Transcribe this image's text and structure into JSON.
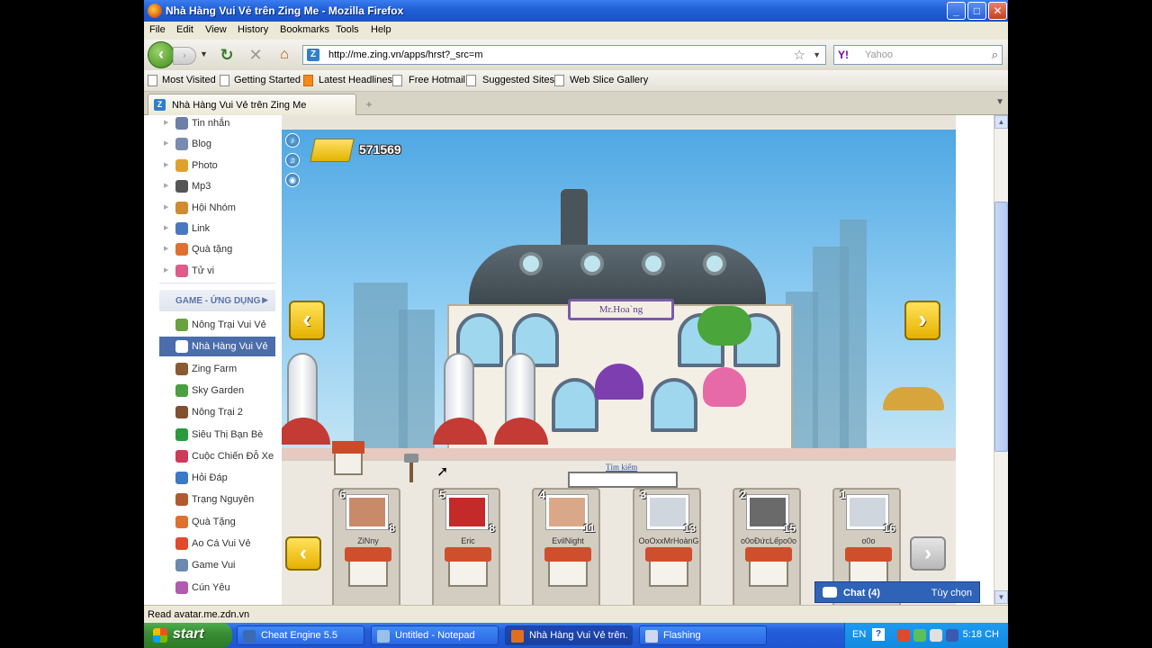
{
  "window": {
    "title": "Nhà Hàng Vui Vẻ trên Zing Me - Mozilla Firefox",
    "controls": [
      "minimize",
      "maximize",
      "close"
    ]
  },
  "menu": [
    "File",
    "Edit",
    "View",
    "History",
    "Bookmarks",
    "Tools",
    "Help"
  ],
  "nav": {
    "url": "http://me.zing.vn/apps/hrst?_src=m",
    "search_placeholder": "Yahoo",
    "search_engine_icon": "Y!"
  },
  "bookmarks": [
    "Most Visited",
    "Getting Started",
    "Latest Headlines",
    "Free Hotmail",
    "Suggested Sites",
    "Web Slice Gallery"
  ],
  "tab": {
    "label": "Nhà Hàng Vui Vẻ trên Zing Me",
    "new_tab": "+"
  },
  "sidebar": {
    "top_items": [
      {
        "label": "Tin nhắn",
        "icon": "message-icon",
        "color": "#6b7fa8"
      },
      {
        "label": "Blog",
        "icon": "blog-icon",
        "color": "#7a8bb0"
      },
      {
        "label": "Photo",
        "icon": "photo-icon",
        "color": "#e0a030"
      },
      {
        "label": "Mp3",
        "icon": "headphones-icon",
        "color": "#555555"
      },
      {
        "label": "Hội Nhóm",
        "icon": "group-icon",
        "color": "#d08a30"
      },
      {
        "label": "Link",
        "icon": "link-icon",
        "color": "#4a78c0"
      },
      {
        "label": "Quà tặng",
        "icon": "gift-icon",
        "color": "#e07030"
      },
      {
        "label": "Tử vi",
        "icon": "horoscope-icon",
        "color": "#e05a8a"
      }
    ],
    "section_title": "GAME - ỨNG DỤNG",
    "apps": [
      {
        "label": "Nông Trại Vui Vẻ",
        "icon": "plant-icon",
        "color": "#6aa040"
      },
      {
        "label": "Nhà Hàng Vui Vẻ",
        "icon": "chef-icon",
        "color": "#ffffff",
        "active": true
      },
      {
        "label": "Zing Farm",
        "icon": "cow-icon",
        "color": "#8a5a30"
      },
      {
        "label": "Sky Garden",
        "icon": "garden-icon",
        "color": "#4aa040"
      },
      {
        "label": "Nông Trại 2",
        "icon": "farmer-icon",
        "color": "#805030"
      },
      {
        "label": "Siêu Thị Bạn Bè",
        "icon": "dollar-icon",
        "color": "#2a9a3a"
      },
      {
        "label": "Cuộc Chiến Đỗ Xe",
        "icon": "car-icon",
        "color": "#d03a5a"
      },
      {
        "label": "Hỏi Đáp",
        "icon": "question-icon",
        "color": "#3a78c8"
      },
      {
        "label": "Trạng Nguyên",
        "icon": "scholar-icon",
        "color": "#b05a30"
      },
      {
        "label": "Quà Tặng",
        "icon": "gift-icon",
        "color": "#e07030"
      },
      {
        "label": "Ao Cá Vui Vẻ",
        "icon": "fish-icon",
        "color": "#e04a2a"
      },
      {
        "label": "Game Vui",
        "icon": "gamepad-icon",
        "color": "#6a8ab0"
      },
      {
        "label": "Cún Yêu",
        "icon": "dog-icon",
        "color": "#b05ab0"
      }
    ]
  },
  "game": {
    "gold": "571569",
    "restaurant_sign": "Mr.Hoa`ng",
    "search_label": "Tìm kiếm",
    "search_value": "",
    "friends": [
      {
        "rank": "6",
        "name": "ZiNny",
        "level": "8",
        "photo_color": "#c98a6a"
      },
      {
        "rank": "5",
        "name": "Eric",
        "level": "8",
        "photo_color": "#c42a2a"
      },
      {
        "rank": "4",
        "name": "EvilNight",
        "level": "11",
        "photo_color": "#d9a888"
      },
      {
        "rank": "3",
        "name": "OoOxxMrHoànG",
        "level": "13",
        "photo_color": "#cfd6de"
      },
      {
        "rank": "2",
        "name": "o0oĐứcLếpo0o",
        "level": "15",
        "photo_color": "#6a6a6a"
      },
      {
        "rank": "1",
        "name": "o0o",
        "level": "16",
        "photo_color": "#cfd6de"
      }
    ]
  },
  "chat": {
    "label": "Chat (4)",
    "options": "Tùy chọn"
  },
  "status": "Read avatar.me.zdn.vn",
  "taskbar": {
    "start": "start",
    "tasks": [
      {
        "label": "Cheat Engine 5.5",
        "color": "#3a6ab0"
      },
      {
        "label": "Untitled - Notepad",
        "color": "#9ac0e8"
      },
      {
        "label": "Nhà Hàng Vui Vẻ trên...",
        "color": "#e07020",
        "active": true
      },
      {
        "label": "Flashing",
        "color": "#d0d8f0"
      }
    ],
    "lang": "EN",
    "time": "5:18 CH"
  }
}
